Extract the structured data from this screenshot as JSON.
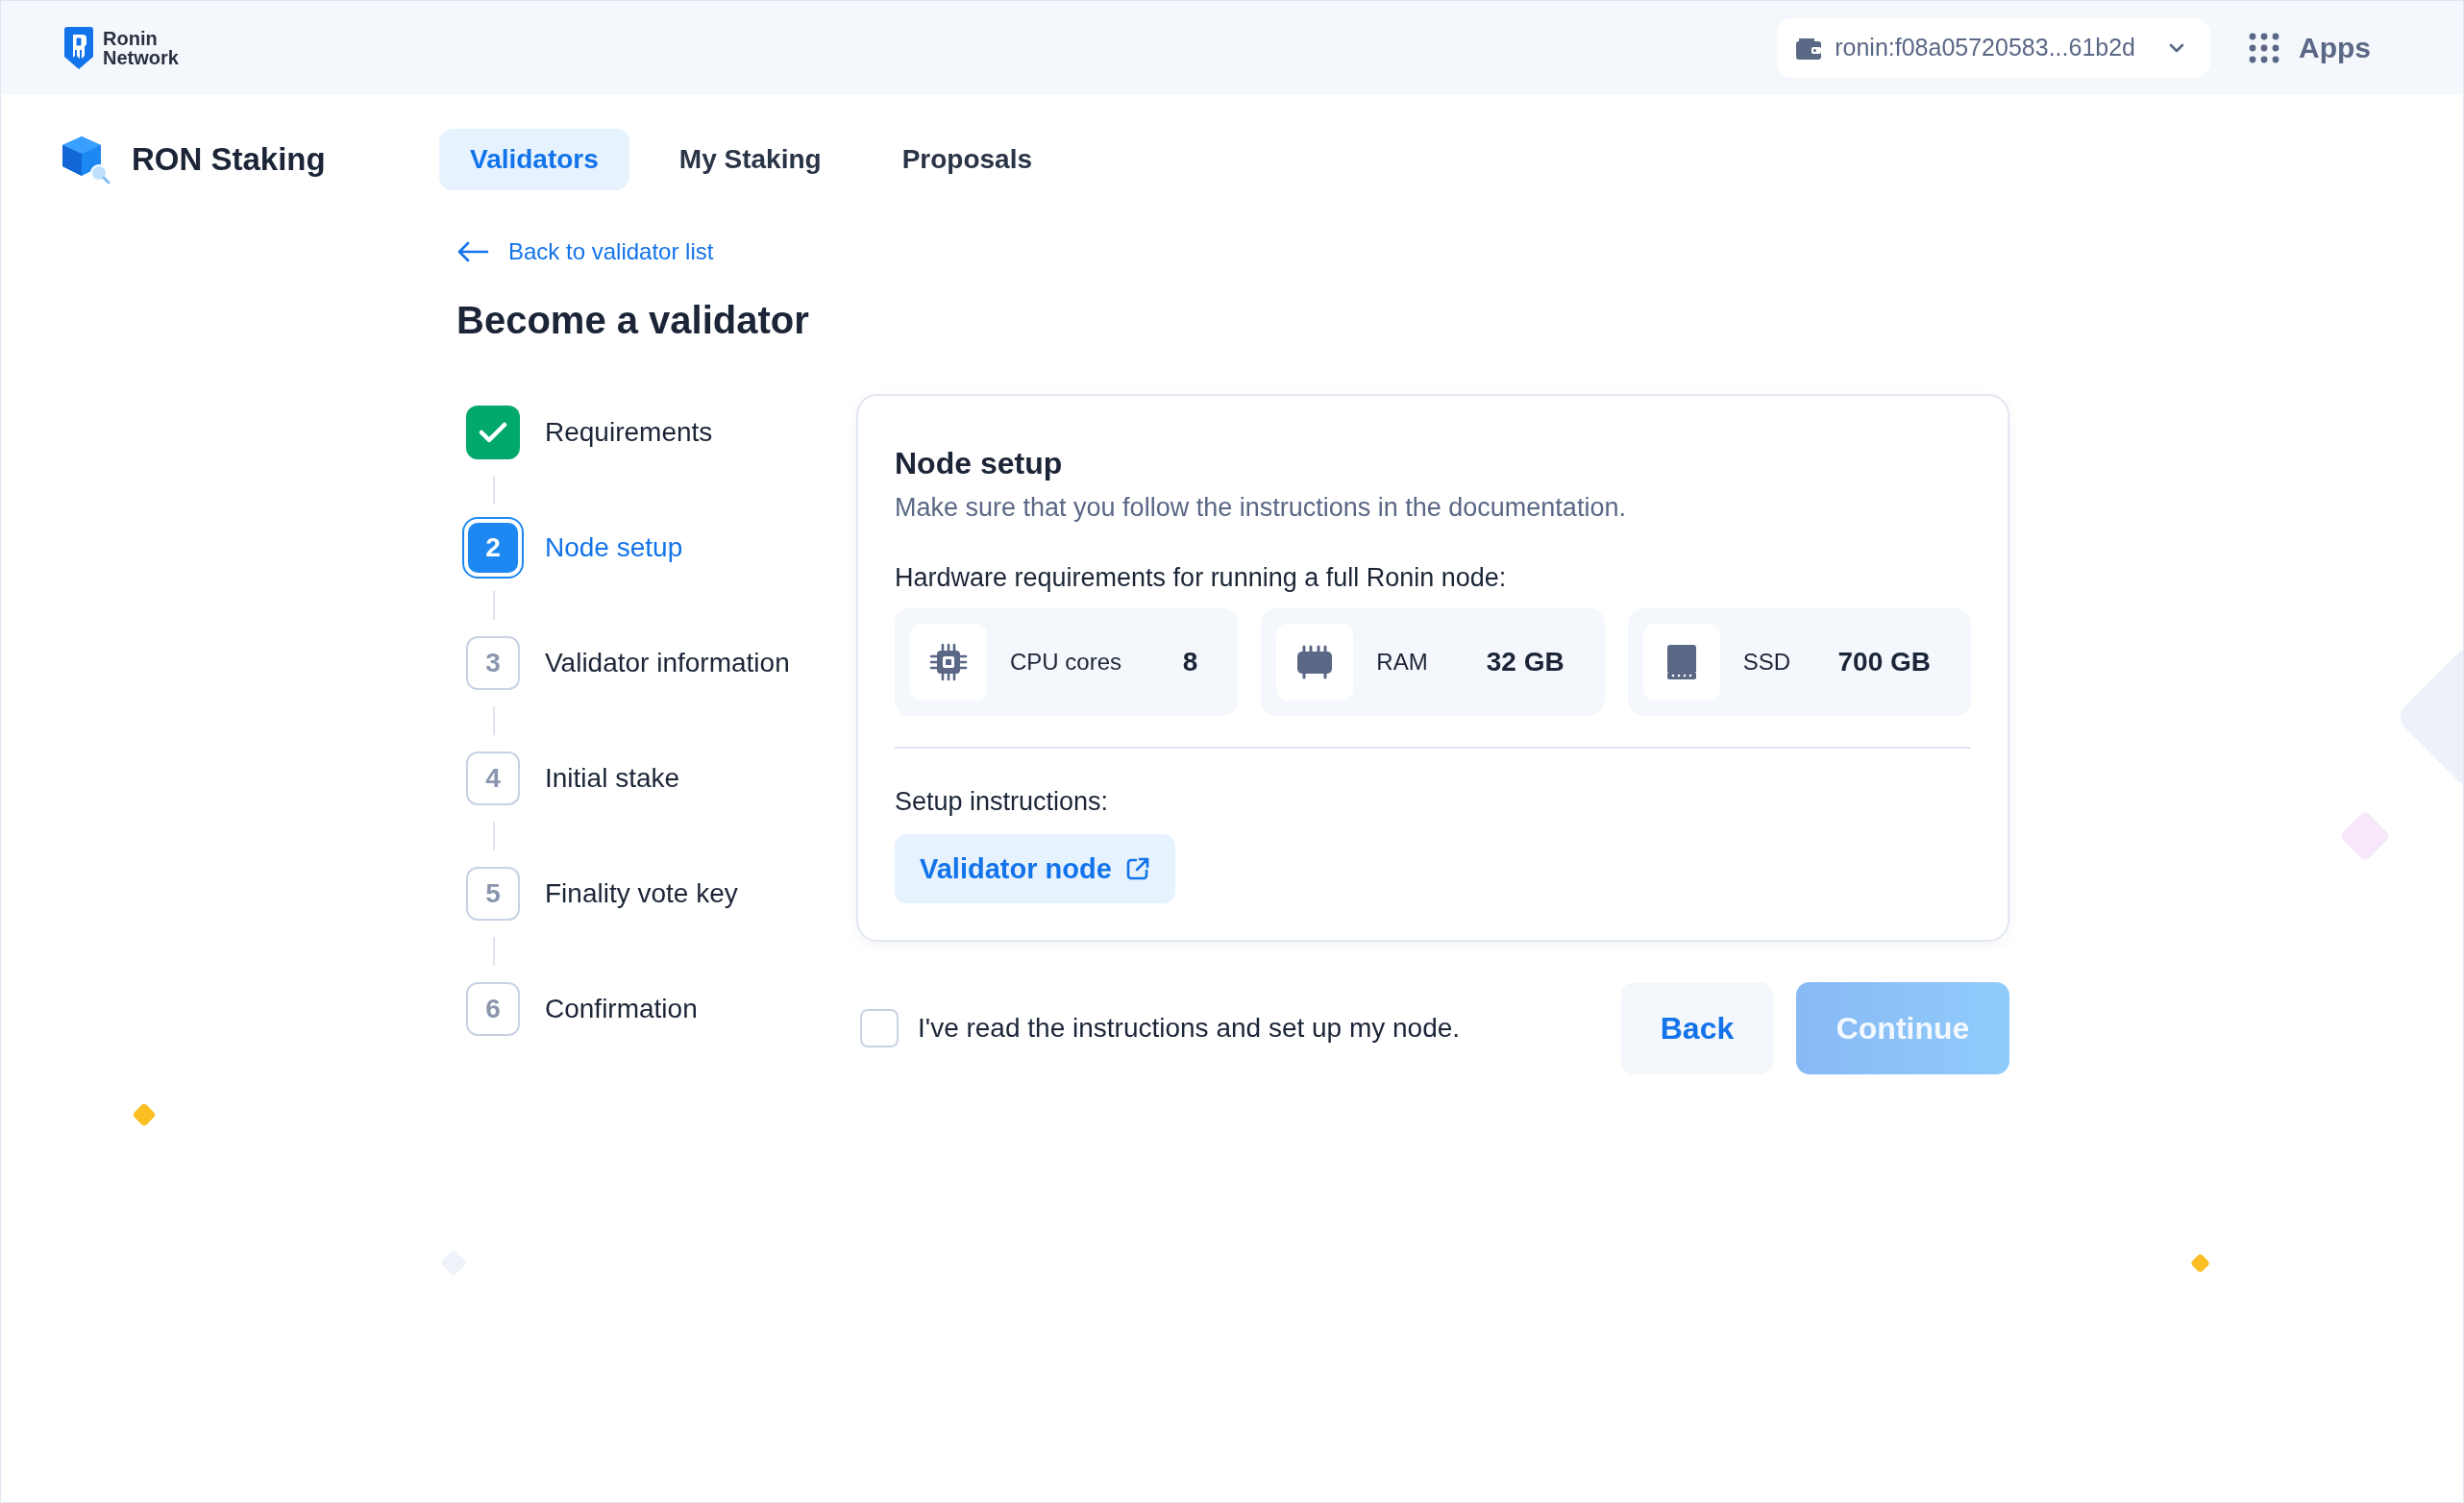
{
  "header": {
    "brand": "Ronin Network",
    "wallet": {
      "address": "ronin:f08a05720583...61b2d"
    },
    "apps": {
      "label": "Apps"
    }
  },
  "app": {
    "title": "RON Staking"
  },
  "tabs": [
    {
      "label": "Validators",
      "selected": true
    },
    {
      "label": "My Staking",
      "selected": false
    },
    {
      "label": "Proposals",
      "selected": false
    }
  ],
  "back_link": "Back to validator list",
  "page_title": "Become a validator",
  "steps": [
    {
      "label": "Requirements",
      "done": true,
      "selected": false
    },
    {
      "number": "2",
      "label": "Node setup",
      "done": false,
      "selected": true
    },
    {
      "number": "3",
      "label": "Validator information",
      "done": false,
      "selected": false
    },
    {
      "number": "4",
      "label": "Initial stake",
      "done": false,
      "selected": false
    },
    {
      "number": "5",
      "label": "Finality vote key",
      "done": false,
      "selected": false
    },
    {
      "number": "6",
      "label": "Confirmation",
      "done": false,
      "selected": false
    }
  ],
  "card": {
    "title": "Node setup",
    "subtitle": "Make sure that you follow the instructions in the documentation.",
    "hardware_label": "Hardware requirements for running a full Ronin node:",
    "specs": [
      {
        "kind": "cpu",
        "label": "CPU cores",
        "value": "8"
      },
      {
        "kind": "ram",
        "label": "RAM",
        "value": "32 GB"
      },
      {
        "kind": "ssd",
        "label": "SSD",
        "value": "700 GB"
      }
    ],
    "instructions_label": "Setup instructions:",
    "link": {
      "label": "Validator node"
    }
  },
  "confirm": {
    "label": "I've read the instructions and set up my node.",
    "checked": false
  },
  "buttons": [
    {
      "label": "Back",
      "kind": "secondary",
      "disabled": false
    },
    {
      "label": "Continue",
      "kind": "primary",
      "disabled": true
    }
  ]
}
